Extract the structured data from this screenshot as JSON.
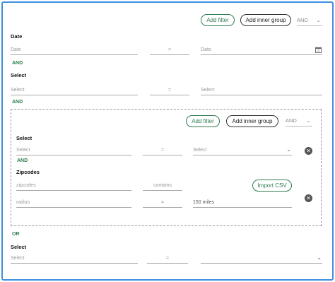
{
  "top": {
    "add_filter": "Add filter",
    "add_inner_group": "Add inner group",
    "operator": "AND"
  },
  "filters": {
    "date": {
      "label": "Date",
      "field_placeholder": "Date",
      "operator": ">",
      "value_placeholder": "Date"
    },
    "conn1": "AND",
    "select1": {
      "label": "Select",
      "field_placeholder": "Select",
      "operator": "=",
      "value_placeholder": "Select"
    },
    "conn2": "AND"
  },
  "inner_group": {
    "add_filter": "Add filter",
    "add_inner_group": "Add inner group",
    "operator": "AND",
    "select": {
      "label": "Select",
      "field_placeholder": "Select",
      "operator": "=",
      "value_placeholder": "Select"
    },
    "conn": "AND",
    "zipcodes": {
      "label": "Zipcodes",
      "field_placeholder": "zipcodes",
      "operator": "contains",
      "import_label": "Import CSV",
      "radius_placeholder": "radius",
      "radius_operator": "=",
      "radius_value": "150 miles"
    }
  },
  "after_group": {
    "conn": "OR",
    "select": {
      "label": "Select",
      "field_placeholder": "Select",
      "operator": "=",
      "value_placeholder": ""
    }
  },
  "colors": {
    "accent": "#2e7d4f",
    "frame": "#3d8fe0"
  },
  "icons": [
    "chevron-down-icon",
    "calendar-icon",
    "close-icon"
  ]
}
